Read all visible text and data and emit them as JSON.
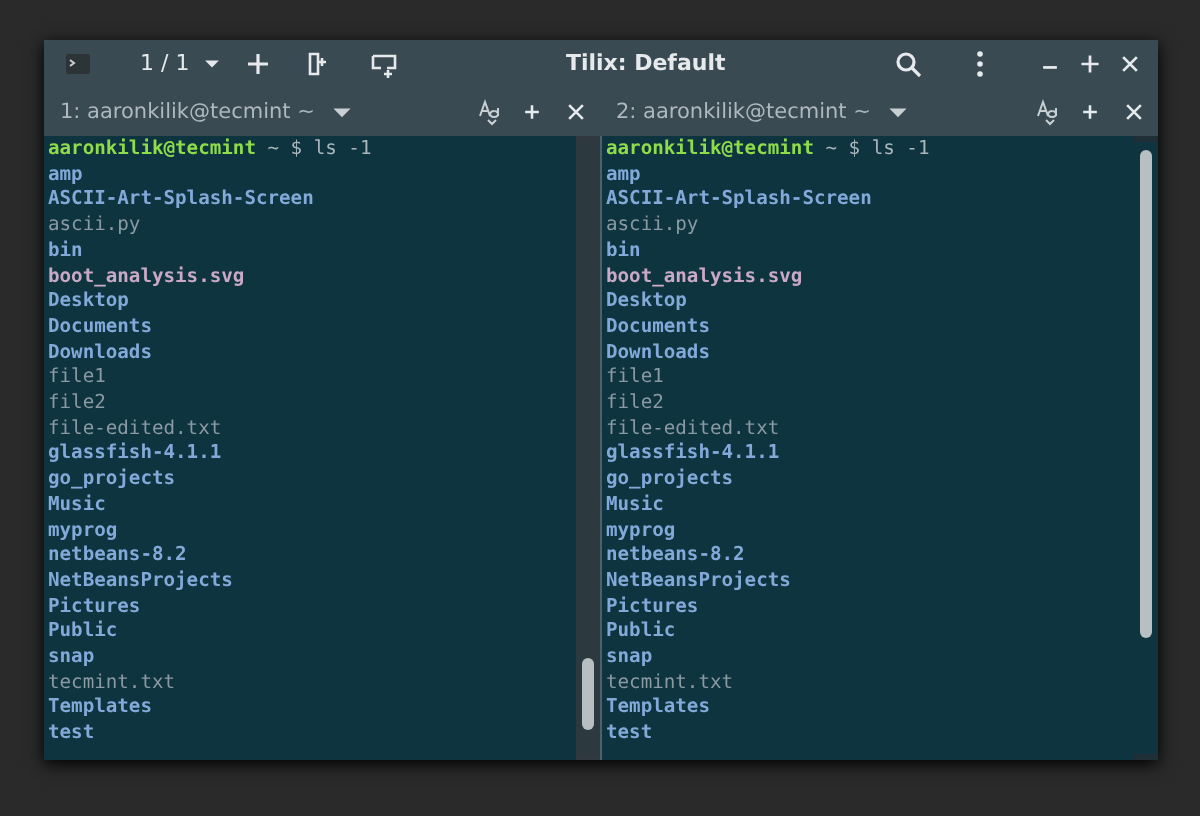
{
  "window": {
    "title": "Tilix: Default",
    "session_counter": "1 / 1"
  },
  "panes": [
    {
      "tab_title": "1: aaronkilik@tecmint ~",
      "prompt_user": "aaronkilik@tecmint",
      "prompt_rest": "~ $ ls -1",
      "entries": [
        {
          "name": "amp",
          "kind": "dir"
        },
        {
          "name": "ASCII-Art-Splash-Screen",
          "kind": "dir"
        },
        {
          "name": "ascii.py",
          "kind": "file"
        },
        {
          "name": "bin",
          "kind": "dir"
        },
        {
          "name": "boot_analysis.svg",
          "kind": "image"
        },
        {
          "name": "Desktop",
          "kind": "dir"
        },
        {
          "name": "Documents",
          "kind": "dir"
        },
        {
          "name": "Downloads",
          "kind": "dir"
        },
        {
          "name": "file1",
          "kind": "file"
        },
        {
          "name": "file2",
          "kind": "file"
        },
        {
          "name": "file-edited.txt",
          "kind": "file"
        },
        {
          "name": "glassfish-4.1.1",
          "kind": "dir"
        },
        {
          "name": "go_projects",
          "kind": "dir"
        },
        {
          "name": "Music",
          "kind": "dir"
        },
        {
          "name": "myprog",
          "kind": "dir"
        },
        {
          "name": "netbeans-8.2",
          "kind": "dir"
        },
        {
          "name": "NetBeansProjects",
          "kind": "dir"
        },
        {
          "name": "Pictures",
          "kind": "dir"
        },
        {
          "name": "Public",
          "kind": "dir"
        },
        {
          "name": "snap",
          "kind": "dir"
        },
        {
          "name": "tecmint.txt",
          "kind": "file"
        },
        {
          "name": "Templates",
          "kind": "dir"
        },
        {
          "name": "test",
          "kind": "dir"
        }
      ]
    },
    {
      "tab_title": "2: aaronkilik@tecmint ~",
      "prompt_user": "aaronkilik@tecmint",
      "prompt_rest": "~ $ ls -1",
      "entries": [
        {
          "name": "amp",
          "kind": "dir"
        },
        {
          "name": "ASCII-Art-Splash-Screen",
          "kind": "dir"
        },
        {
          "name": "ascii.py",
          "kind": "file"
        },
        {
          "name": "bin",
          "kind": "dir"
        },
        {
          "name": "boot_analysis.svg",
          "kind": "image"
        },
        {
          "name": "Desktop",
          "kind": "dir"
        },
        {
          "name": "Documents",
          "kind": "dir"
        },
        {
          "name": "Downloads",
          "kind": "dir"
        },
        {
          "name": "file1",
          "kind": "file"
        },
        {
          "name": "file2",
          "kind": "file"
        },
        {
          "name": "file-edited.txt",
          "kind": "file"
        },
        {
          "name": "glassfish-4.1.1",
          "kind": "dir"
        },
        {
          "name": "go_projects",
          "kind": "dir"
        },
        {
          "name": "Music",
          "kind": "dir"
        },
        {
          "name": "myprog",
          "kind": "dir"
        },
        {
          "name": "netbeans-8.2",
          "kind": "dir"
        },
        {
          "name": "NetBeansProjects",
          "kind": "dir"
        },
        {
          "name": "Pictures",
          "kind": "dir"
        },
        {
          "name": "Public",
          "kind": "dir"
        },
        {
          "name": "snap",
          "kind": "dir"
        },
        {
          "name": "tecmint.txt",
          "kind": "file"
        },
        {
          "name": "Templates",
          "kind": "dir"
        },
        {
          "name": "test",
          "kind": "dir"
        }
      ]
    }
  ]
}
